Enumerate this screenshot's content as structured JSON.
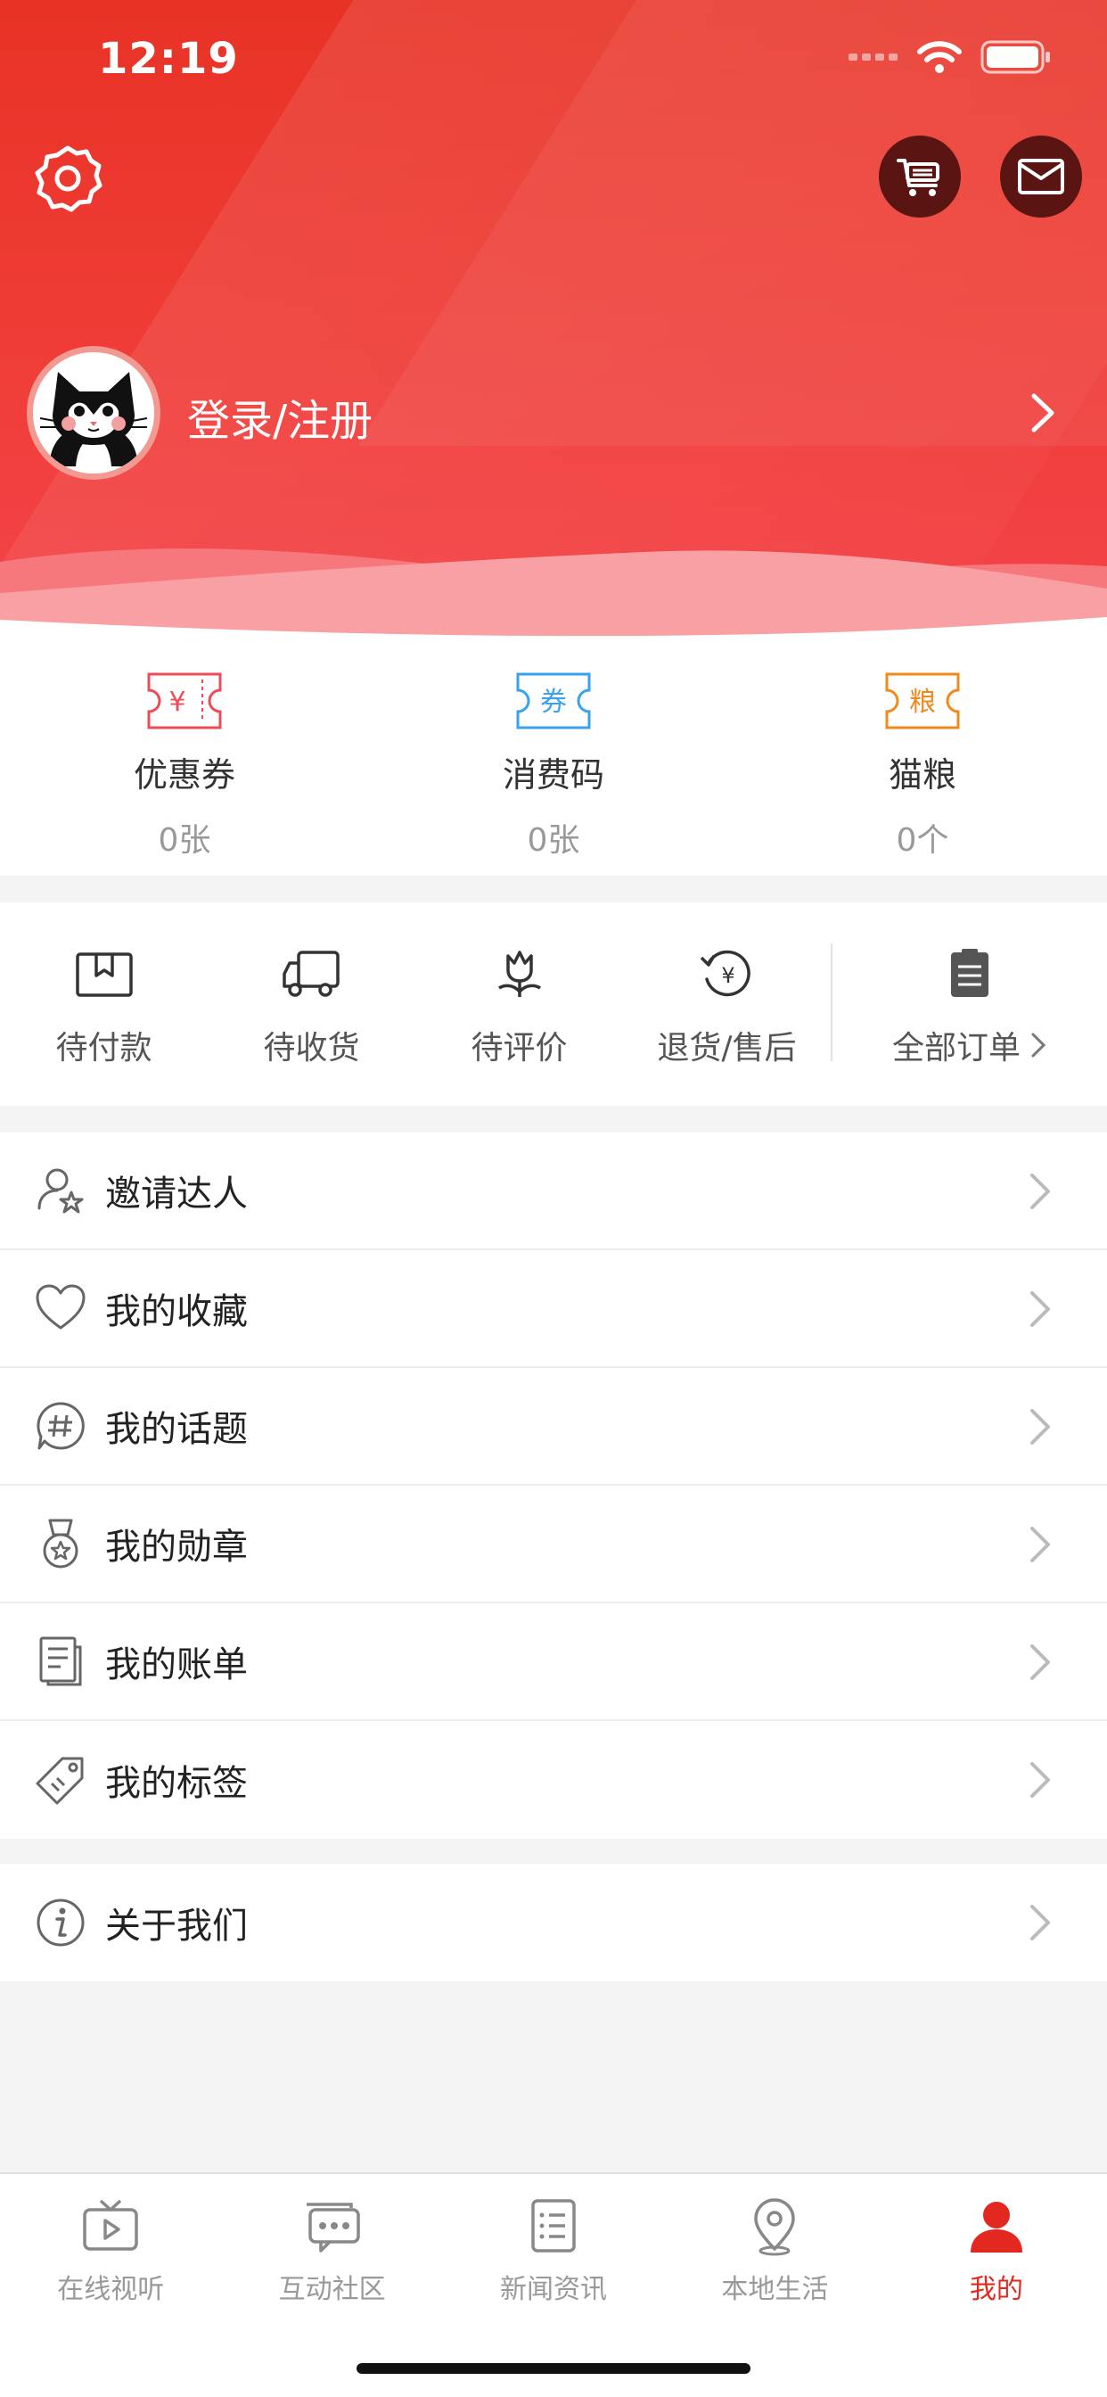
{
  "status_bar": {
    "time": "12:19"
  },
  "profile": {
    "login_label": "登录/注册"
  },
  "assets": [
    {
      "icon": "coupon-icon",
      "badge": "¥",
      "label": "优惠券",
      "value": "0张",
      "color": "#ef4b57"
    },
    {
      "icon": "voucher-icon",
      "badge": "券",
      "label": "消费码",
      "value": "0张",
      "color": "#3aa1ee"
    },
    {
      "icon": "cat-food-icon",
      "badge": "粮",
      "label": "猫粮",
      "value": "0个",
      "color": "#f08a1c"
    }
  ],
  "orders": [
    {
      "icon": "pending-payment-icon",
      "label": "待付款"
    },
    {
      "icon": "delivery-truck-icon",
      "label": "待收货"
    },
    {
      "icon": "review-flower-icon",
      "label": "待评价"
    },
    {
      "icon": "refund-icon",
      "label": "退货/售后"
    }
  ],
  "orders_all": {
    "icon": "clipboard-icon",
    "label": "全部订单"
  },
  "menu": [
    {
      "icon": "invite-user-icon",
      "label": "邀请达人"
    },
    {
      "icon": "heart-icon",
      "label": "我的收藏"
    },
    {
      "icon": "hashtag-icon",
      "label": "我的话题"
    },
    {
      "icon": "medal-icon",
      "label": "我的勋章"
    },
    {
      "icon": "bill-icon",
      "label": "我的账单"
    },
    {
      "icon": "tag-icon",
      "label": "我的标签"
    }
  ],
  "menu_about": {
    "icon": "info-icon",
    "label": "关于我们"
  },
  "tabbar": [
    {
      "icon": "tv-icon",
      "label": "在线视听",
      "active": false
    },
    {
      "icon": "chat-icon",
      "label": "互动社区",
      "active": false
    },
    {
      "icon": "news-icon",
      "label": "新闻资讯",
      "active": false
    },
    {
      "icon": "location-icon",
      "label": "本地生活",
      "active": false
    },
    {
      "icon": "user-icon",
      "label": "我的",
      "active": true
    }
  ],
  "colors": {
    "brand_red": "#e83226",
    "active_tab": "#e3281f"
  }
}
